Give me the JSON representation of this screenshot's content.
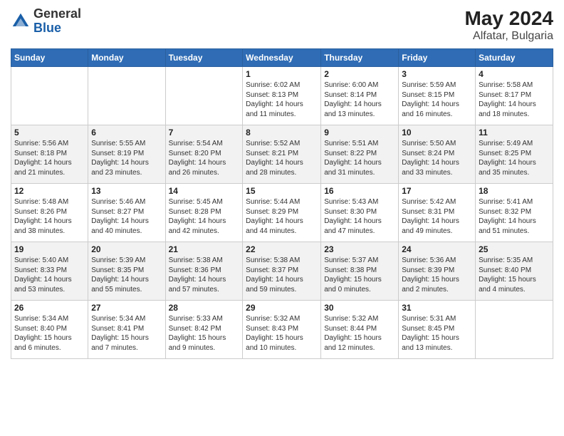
{
  "header": {
    "logo_general": "General",
    "logo_blue": "Blue",
    "month_year": "May 2024",
    "location": "Alfatar, Bulgaria"
  },
  "weekdays": [
    "Sunday",
    "Monday",
    "Tuesday",
    "Wednesday",
    "Thursday",
    "Friday",
    "Saturday"
  ],
  "weeks": [
    [
      {
        "day": "",
        "info": ""
      },
      {
        "day": "",
        "info": ""
      },
      {
        "day": "",
        "info": ""
      },
      {
        "day": "1",
        "info": "Sunrise: 6:02 AM\nSunset: 8:13 PM\nDaylight: 14 hours\nand 11 minutes."
      },
      {
        "day": "2",
        "info": "Sunrise: 6:00 AM\nSunset: 8:14 PM\nDaylight: 14 hours\nand 13 minutes."
      },
      {
        "day": "3",
        "info": "Sunrise: 5:59 AM\nSunset: 8:15 PM\nDaylight: 14 hours\nand 16 minutes."
      },
      {
        "day": "4",
        "info": "Sunrise: 5:58 AM\nSunset: 8:17 PM\nDaylight: 14 hours\nand 18 minutes."
      }
    ],
    [
      {
        "day": "5",
        "info": "Sunrise: 5:56 AM\nSunset: 8:18 PM\nDaylight: 14 hours\nand 21 minutes."
      },
      {
        "day": "6",
        "info": "Sunrise: 5:55 AM\nSunset: 8:19 PM\nDaylight: 14 hours\nand 23 minutes."
      },
      {
        "day": "7",
        "info": "Sunrise: 5:54 AM\nSunset: 8:20 PM\nDaylight: 14 hours\nand 26 minutes."
      },
      {
        "day": "8",
        "info": "Sunrise: 5:52 AM\nSunset: 8:21 PM\nDaylight: 14 hours\nand 28 minutes."
      },
      {
        "day": "9",
        "info": "Sunrise: 5:51 AM\nSunset: 8:22 PM\nDaylight: 14 hours\nand 31 minutes."
      },
      {
        "day": "10",
        "info": "Sunrise: 5:50 AM\nSunset: 8:24 PM\nDaylight: 14 hours\nand 33 minutes."
      },
      {
        "day": "11",
        "info": "Sunrise: 5:49 AM\nSunset: 8:25 PM\nDaylight: 14 hours\nand 35 minutes."
      }
    ],
    [
      {
        "day": "12",
        "info": "Sunrise: 5:48 AM\nSunset: 8:26 PM\nDaylight: 14 hours\nand 38 minutes."
      },
      {
        "day": "13",
        "info": "Sunrise: 5:46 AM\nSunset: 8:27 PM\nDaylight: 14 hours\nand 40 minutes."
      },
      {
        "day": "14",
        "info": "Sunrise: 5:45 AM\nSunset: 8:28 PM\nDaylight: 14 hours\nand 42 minutes."
      },
      {
        "day": "15",
        "info": "Sunrise: 5:44 AM\nSunset: 8:29 PM\nDaylight: 14 hours\nand 44 minutes."
      },
      {
        "day": "16",
        "info": "Sunrise: 5:43 AM\nSunset: 8:30 PM\nDaylight: 14 hours\nand 47 minutes."
      },
      {
        "day": "17",
        "info": "Sunrise: 5:42 AM\nSunset: 8:31 PM\nDaylight: 14 hours\nand 49 minutes."
      },
      {
        "day": "18",
        "info": "Sunrise: 5:41 AM\nSunset: 8:32 PM\nDaylight: 14 hours\nand 51 minutes."
      }
    ],
    [
      {
        "day": "19",
        "info": "Sunrise: 5:40 AM\nSunset: 8:33 PM\nDaylight: 14 hours\nand 53 minutes."
      },
      {
        "day": "20",
        "info": "Sunrise: 5:39 AM\nSunset: 8:35 PM\nDaylight: 14 hours\nand 55 minutes."
      },
      {
        "day": "21",
        "info": "Sunrise: 5:38 AM\nSunset: 8:36 PM\nDaylight: 14 hours\nand 57 minutes."
      },
      {
        "day": "22",
        "info": "Sunrise: 5:38 AM\nSunset: 8:37 PM\nDaylight: 14 hours\nand 59 minutes."
      },
      {
        "day": "23",
        "info": "Sunrise: 5:37 AM\nSunset: 8:38 PM\nDaylight: 15 hours\nand 0 minutes."
      },
      {
        "day": "24",
        "info": "Sunrise: 5:36 AM\nSunset: 8:39 PM\nDaylight: 15 hours\nand 2 minutes."
      },
      {
        "day": "25",
        "info": "Sunrise: 5:35 AM\nSunset: 8:40 PM\nDaylight: 15 hours\nand 4 minutes."
      }
    ],
    [
      {
        "day": "26",
        "info": "Sunrise: 5:34 AM\nSunset: 8:40 PM\nDaylight: 15 hours\nand 6 minutes."
      },
      {
        "day": "27",
        "info": "Sunrise: 5:34 AM\nSunset: 8:41 PM\nDaylight: 15 hours\nand 7 minutes."
      },
      {
        "day": "28",
        "info": "Sunrise: 5:33 AM\nSunset: 8:42 PM\nDaylight: 15 hours\nand 9 minutes."
      },
      {
        "day": "29",
        "info": "Sunrise: 5:32 AM\nSunset: 8:43 PM\nDaylight: 15 hours\nand 10 minutes."
      },
      {
        "day": "30",
        "info": "Sunrise: 5:32 AM\nSunset: 8:44 PM\nDaylight: 15 hours\nand 12 minutes."
      },
      {
        "day": "31",
        "info": "Sunrise: 5:31 AM\nSunset: 8:45 PM\nDaylight: 15 hours\nand 13 minutes."
      },
      {
        "day": "",
        "info": ""
      }
    ]
  ]
}
